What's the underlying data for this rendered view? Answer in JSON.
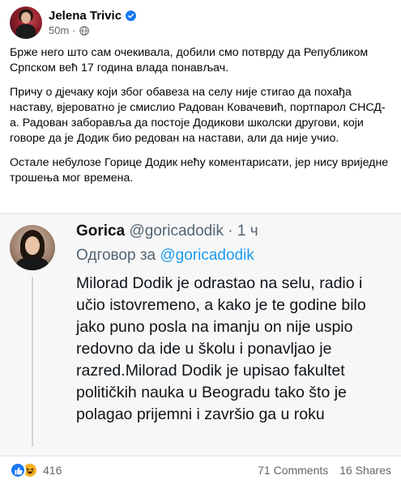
{
  "post": {
    "author": "Jelena Trivic",
    "time": "50m",
    "separator": "·",
    "paragraphs": [
      "Брже него што сам очекивала, добили смо потврду да Републиком Српском већ 17 година влада понављач.",
      "Причу о дјечаку који због обавеза на селу није стигао да похађа наставу, вјероватно је смислио Радован Ковачевић, портпарол СНСД-а. Радован заборавља да постоје Додикови школски другови, који говоре да је Додик био редован на настави, али да није учио.",
      "Остале небулозе Горице Додик нећу коментарисати, јер нису вриједне трошења мог времена."
    ]
  },
  "tweet": {
    "name": "Gorica",
    "handle": "@goricadodik",
    "separator": "·",
    "time": "1 ч",
    "reply_prefix": "Одговор за",
    "reply_to": "@goricadodik",
    "body": "Milorad Dodik je odrastao na selu, radio i učio istovremeno, a kako je te godine bilo jako puno posla na imanju on nije uspio redovno da ide u školu i ponavljao je razred.Milorad Dodik je upisao fakultet političkih nauka u Beogradu tako što je polagao prijemni i završio ga u roku"
  },
  "footer": {
    "reaction_count": "416",
    "comments": "71 Comments",
    "shares": "16 Shares"
  },
  "colors": {
    "verified": "#1877f2",
    "like": "#1877f2",
    "haha": "#f7b125",
    "mention": "#1d9bf0"
  },
  "icons": {
    "verified": "verified-badge-icon",
    "privacy": "globe-icon",
    "like": "like-reaction-icon",
    "haha": "haha-reaction-icon"
  }
}
